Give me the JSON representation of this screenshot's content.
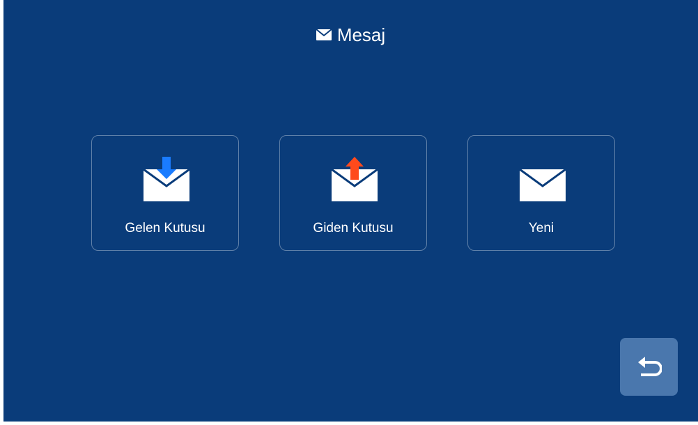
{
  "header": {
    "title": "Mesaj",
    "icon": "envelope-icon"
  },
  "tiles": [
    {
      "label": "Gelen Kutusu",
      "icon": "inbox-envelope-icon",
      "arrow_color": "#1a7cff"
    },
    {
      "label": "Giden Kutusu",
      "icon": "outbox-envelope-icon",
      "arrow_color": "#ff4a1c"
    },
    {
      "label": "Yeni",
      "icon": "new-envelope-icon"
    }
  ],
  "back_button": {
    "icon": "back-arrow-icon"
  },
  "colors": {
    "background": "#0a3c7a",
    "tile_border": "#5a7fae",
    "back_button": "#4a77ad",
    "envelope": "#ffffff"
  }
}
